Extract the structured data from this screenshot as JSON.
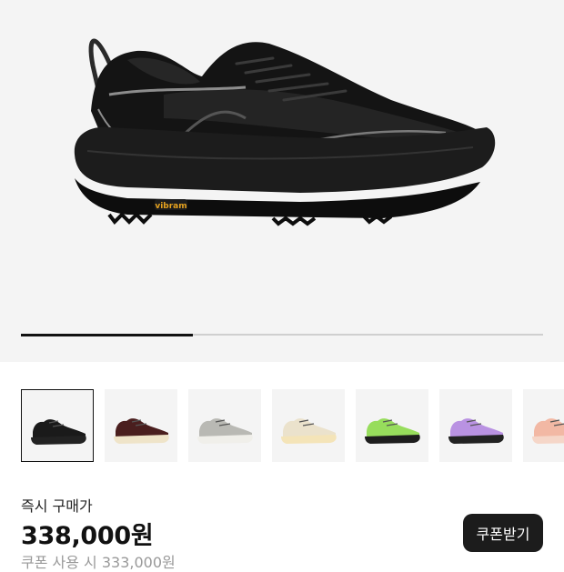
{
  "gallery": {
    "progress": 0.33,
    "main_shoe": {
      "icon": "running-shoe-black",
      "colors": {
        "upper": "#141414",
        "sole": "#1c1c1c",
        "accent": "#8d8d8d",
        "logo": "#e6a21e"
      }
    },
    "thumbnails": [
      {
        "icon": "running-shoe-black",
        "upper": "#1a1a1a",
        "sole": "#222222",
        "selected": true
      },
      {
        "icon": "running-shoe-brown",
        "upper": "#4a1e1e",
        "sole": "#efe4c9",
        "selected": false
      },
      {
        "icon": "running-shoe-silver",
        "upper": "#b9b9b4",
        "sole": "#f0efea",
        "selected": false
      },
      {
        "icon": "running-shoe-cream",
        "upper": "#ebe2cc",
        "sole": "#f4e4b8",
        "selected": false
      },
      {
        "icon": "running-shoe-lime",
        "upper": "#97dd5c",
        "sole": "#1d1d1d",
        "selected": false
      },
      {
        "icon": "running-shoe-lavender",
        "upper": "#b992e2",
        "sole": "#222222",
        "selected": false
      },
      {
        "icon": "running-shoe-peach",
        "upper": "#f2b8a4",
        "sole": "#f5d6c8",
        "selected": false
      }
    ]
  },
  "purchase": {
    "label": "즉시 구매가",
    "price": "338,000원",
    "coupon_note": "쿠폰 사용 시 333,000원",
    "coupon_button": "쿠폰받기"
  }
}
